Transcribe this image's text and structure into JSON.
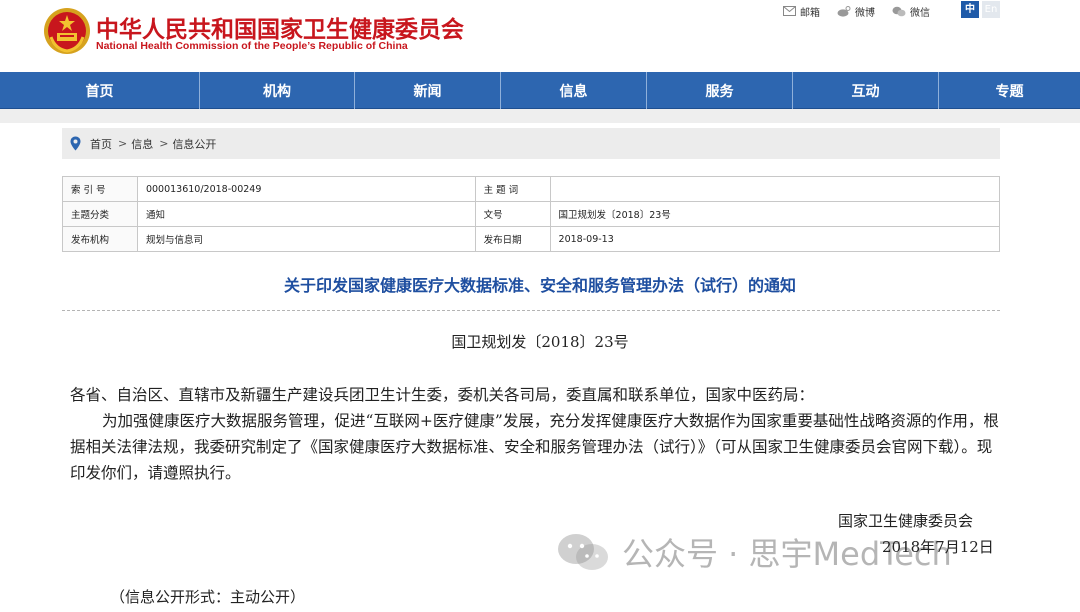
{
  "header": {
    "title_cn": "中华人民共和国国家卫生健康委员会",
    "title_en": "National Health Commission of the People’s Republic of China",
    "links": [
      {
        "label": "邮箱",
        "icon": "mail-icon"
      },
      {
        "label": "微博",
        "icon": "weibo-icon"
      },
      {
        "label": "微信",
        "icon": "wechat-icon"
      }
    ],
    "lang_zh": "中",
    "lang_en": "En"
  },
  "nav": {
    "items": [
      "首页",
      "机构",
      "新闻",
      "信息",
      "服务",
      "互动",
      "专题"
    ]
  },
  "breadcrumb": {
    "items": [
      "首页",
      "信息",
      "信息公开"
    ],
    "separator": ">"
  },
  "info_table": {
    "rows": [
      {
        "label1": "索 引 号",
        "value1": "000013610/2018-00249",
        "label2": "主 题 词",
        "value2": ""
      },
      {
        "label1": "主题分类",
        "value1": "通知",
        "label2": "文号",
        "value2": "国卫规划发〔2018〕23号"
      },
      {
        "label1": "发布机构",
        "value1": "规划与信息司",
        "label2": "发布日期",
        "value2": "2018-09-13"
      }
    ]
  },
  "document": {
    "title": "关于印发国家健康医疗大数据标准、安全和服务管理办法（试行）的通知",
    "number": "国卫规划发〔2018〕23号",
    "salutation": "各省、自治区、直辖市及新疆生产建设兵团卫生计生委，委机关各司局，委直属和联系单位，国家中医药局：",
    "paragraph": "为加强健康医疗大数据服务管理，促进“互联网+医疗健康”发展，充分发挥健康医疗大数据作为国家重要基础性战略资源的作用，根据相关法律法规，我委研究制定了《国家健康医疗大数据标准、安全和服务管理办法（试行）》（可从国家卫生健康委员会官网下载）。现印发你们，请遵照执行。",
    "signature_org": "国家卫生健康委员会",
    "signature_date": "2018年7月12日",
    "disclosure": "（信息公开形式：主动公开）"
  },
  "watermark": {
    "text": "公众号 · 思宇MedTech"
  },
  "colors": {
    "brand_red": "#c8161d",
    "nav_blue": "#2d66b0",
    "title_blue": "#1f4fa0"
  }
}
